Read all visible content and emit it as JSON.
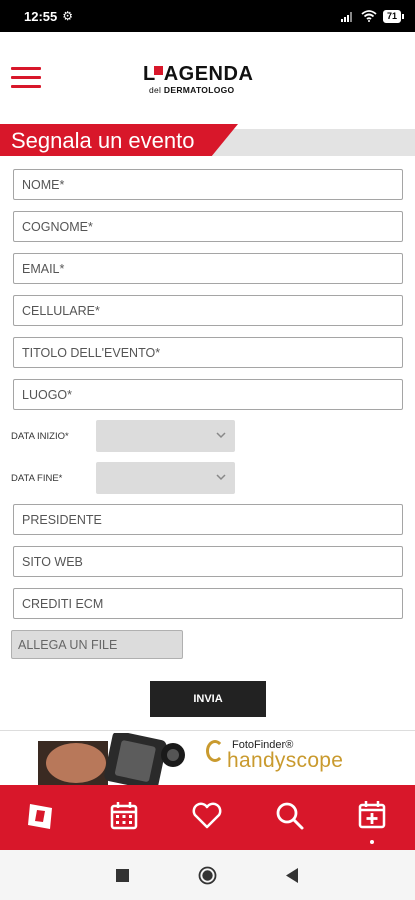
{
  "status_bar": {
    "time": "12:55",
    "battery": "71"
  },
  "header": {
    "logo_main": "AGENDA",
    "logo_l": "L",
    "logo_sub_prefix": "del",
    "logo_sub_bold": "DERMATOLOGO"
  },
  "section_title": "Segnala un evento",
  "form": {
    "nome": "NOME*",
    "cognome": "COGNOME*",
    "email": "EMAIL*",
    "cellulare": "CELLULARE*",
    "titolo": "TITOLO DELL'EVENTO*",
    "luogo": "LUOGO*",
    "data_inizio_label": "DATA INIZIO*",
    "data_fine_label": "DATA FINE*",
    "presidente": "PRESIDENTE",
    "sito_web": "SITO WEB",
    "crediti": "CREDITI ECM",
    "attach": "ALLEGA UN FILE",
    "submit": "INVIA"
  },
  "ad": {
    "brand_top": "FotoFinder®",
    "brand_main": "handyscope"
  },
  "colors": {
    "accent": "#d8172a",
    "dark": "#222222",
    "gold": "#c99a2e"
  },
  "icons": {
    "nav": [
      "logo-icon",
      "calendar-icon",
      "heart-icon",
      "search-icon",
      "calendar-plus-icon"
    ],
    "system": [
      "recents-icon",
      "home-icon",
      "back-icon"
    ]
  }
}
